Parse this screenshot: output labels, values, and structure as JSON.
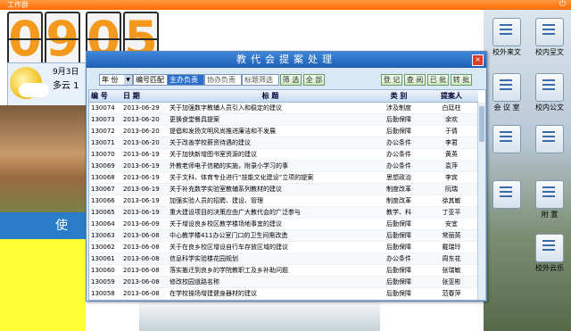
{
  "topbar": {
    "title": "工作群",
    "power_icon": "power-icon"
  },
  "clock": {
    "digits": [
      "0",
      "9",
      "0",
      "5"
    ]
  },
  "weather": {
    "date": "9月3日",
    "condition": "多云 1"
  },
  "left_banner": "使 术",
  "desktop_icons": [
    {
      "label": "校外来文",
      "icon": "document-icon"
    },
    {
      "label": "校内呈文",
      "icon": "document-icon"
    },
    {
      "label": "会 议 室",
      "icon": "meeting-icon"
    },
    {
      "label": "校内公文",
      "icon": "document-icon"
    },
    {
      "label": "",
      "icon": "apps-icon"
    },
    {
      "label": "",
      "icon": "calendar-icon"
    },
    {
      "label": "",
      "icon": "person-icon"
    },
    {
      "label": "附 置",
      "icon": "attachment-icon"
    },
    {
      "label": "校外云乐",
      "icon": "cloud-icon"
    }
  ],
  "dialog": {
    "title": "教代会提案处理",
    "close": "×",
    "filters": {
      "year": "年 份",
      "number_match": "编号匹配",
      "main_handler_placeholder": "主办负责",
      "co_handler_placeholder": "协办负责",
      "title_filter_placeholder": "标题筛选",
      "search_btn": "筛 选",
      "all_btn": "全 部",
      "register_btn": "登 记",
      "view_btn": "查 阅",
      "done_btn": "已 批",
      "delete_btn": "转 批"
    },
    "columns": [
      "编 号",
      "日 期",
      "标 题",
      "类 别",
      "提案人"
    ],
    "rows": [
      [
        "130074",
        "2013-06-29",
        "关于加强数字教辅人员引入和稳定的建议",
        "涉及制度",
        "白廷柱"
      ],
      [
        "130073",
        "2013-06-20",
        "更换食堂餐具提案",
        "后勤保障",
        "余欢"
      ],
      [
        "130072",
        "2013-06-20",
        "提倡和发扬文明风尚推进廉洁和不发展",
        "后勤保障",
        "于倩"
      ],
      [
        "130071",
        "2013-06-20",
        "关于改善学校薪资待遇的建议",
        "办公条件",
        "李君"
      ],
      [
        "130070",
        "2013-06-19",
        "关于加快新增图书室资源的建议",
        "办公条件",
        "黄英"
      ],
      [
        "130069",
        "2013-06-19",
        "外教老师电子信箱的实施，附录小学习的事",
        "办公条件",
        "袁萍"
      ],
      [
        "130068",
        "2013-06-19",
        "关于文科、体育专业进行“技能文化建设”立项的提案",
        "思想政治",
        "李宾"
      ],
      [
        "130067",
        "2013-06-19",
        "关于补充数学实验室教辅系列教材的建议",
        "制度改革",
        "阮瑞"
      ],
      [
        "130066",
        "2013-06-19",
        "加强实验人员的招聘、建设、管理",
        "制度改革",
        "徐其敏"
      ],
      [
        "130065",
        "2013-06-19",
        "重大建设项目的决策应由广大教代会的广泛参与",
        "教学、科",
        "丁亚平"
      ],
      [
        "130064",
        "2013-06-09",
        "关于增设良乡校区教学楼场地事宜的建议",
        "后勤保障",
        "安宜"
      ],
      [
        "130063",
        "2013-06-08",
        "中心教学楼411办公室门口的卫生间需改造",
        "后勤保障",
        "常丽英"
      ],
      [
        "130062",
        "2013-06-08",
        "关于在良乡校区增设自行车存放区域的建议",
        "后勤保障",
        "戴瑞玲"
      ],
      [
        "130061",
        "2013-06-08",
        "信息科学实验楼花园规划",
        "办公条件",
        "周东花"
      ],
      [
        "130060",
        "2013-06-08",
        "落实搬迁到良乡的学院教职工及乡补助问题",
        "后勤保障",
        "张瑞敏"
      ],
      [
        "130059",
        "2013-06-08",
        "修改校园道路名称",
        "后勤保障",
        "张亚彬"
      ],
      [
        "130058",
        "2013-06-08",
        "在学校操场增建健身器材的建议",
        "后勤保障",
        "范春萍"
      ]
    ]
  },
  "colors": {
    "topbar": "#ff7a10",
    "dialog_title": "#2a6fc8",
    "clock_digit": "#f39a1e"
  }
}
